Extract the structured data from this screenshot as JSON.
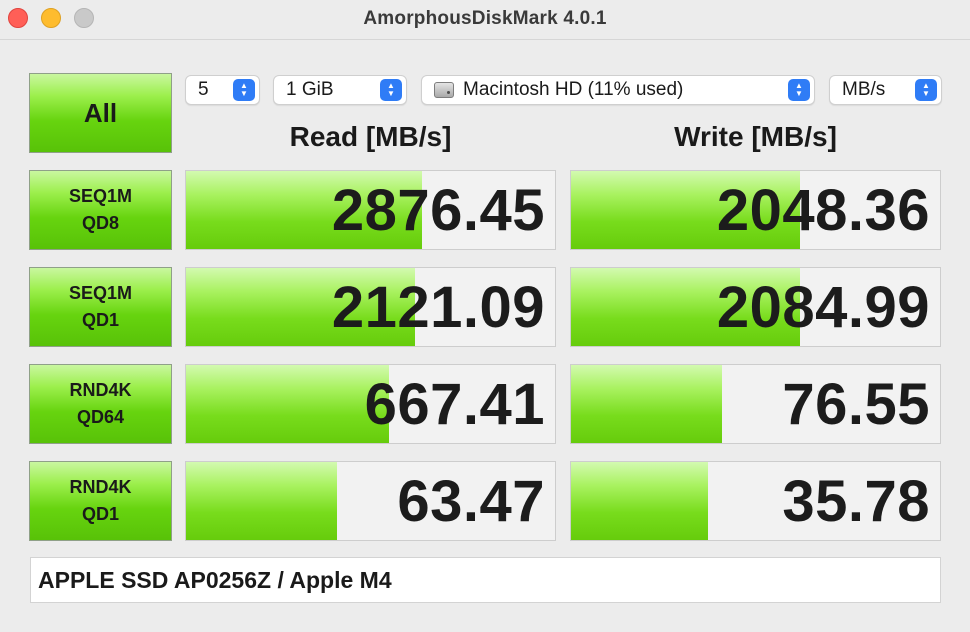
{
  "window": {
    "title": "AmorphousDiskMark 4.0.1"
  },
  "buttons": {
    "all_label": "All",
    "tests": [
      {
        "line1": "SEQ1M",
        "line2": "QD8"
      },
      {
        "line1": "SEQ1M",
        "line2": "QD1"
      },
      {
        "line1": "RND4K",
        "line2": "QD64"
      },
      {
        "line1": "RND4K",
        "line2": "QD1"
      }
    ]
  },
  "controls": {
    "count": "5",
    "size": "1 GiB",
    "disk": "Macintosh HD (11% used)",
    "unit": "MB/s"
  },
  "headers": {
    "read": "Read [MB/s]",
    "write": "Write [MB/s]"
  },
  "results": [
    {
      "read": "2876.45",
      "write": "2048.36",
      "read_fill": 0.64,
      "write_fill": 0.62
    },
    {
      "read": "2121.09",
      "write": "2084.99",
      "read_fill": 0.62,
      "write_fill": 0.62
    },
    {
      "read": "667.41",
      "write": "76.55",
      "read_fill": 0.55,
      "write_fill": 0.41
    },
    {
      "read": "63.47",
      "write": "35.78",
      "read_fill": 0.41,
      "write_fill": 0.37
    }
  ],
  "footer": {
    "device": "APPLE SSD AP0256Z / Apple M4"
  },
  "colors": {
    "accent_blue": "#2f7cf6",
    "green_fill": "#78dc1c",
    "close": "#ff5f57",
    "minimize": "#febc2e"
  }
}
